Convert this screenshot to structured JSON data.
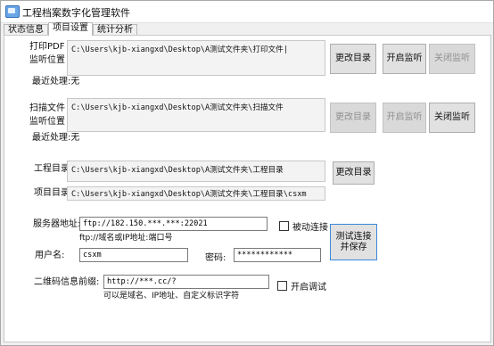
{
  "window": {
    "title": "工程档案数字化管理软件"
  },
  "tabs": [
    "状态信息",
    "项目设置",
    "统计分析"
  ],
  "print_monitor": {
    "label_line1": "打印PDF",
    "label_line2": "监听位置",
    "path": "C:\\Users\\kjb-xiangxd\\Desktop\\A测试文件夹\\打印文件|",
    "change_btn": "更改目录",
    "start_btn": "开启监听",
    "stop_btn": "关闭监听",
    "recent": "最近处理:无"
  },
  "scan_monitor": {
    "label_line1": "扫描文件",
    "label_line2": "监听位置",
    "path": "C:\\Users\\kjb-xiangxd\\Desktop\\A测试文件夹\\扫描文件",
    "change_btn": "更改目录",
    "start_btn": "开启监听",
    "stop_btn": "关闭监听",
    "recent": "最近处理:无"
  },
  "project_dirs": {
    "work_label": "工程目录",
    "work_path": "C:\\Users\\kjb-xiangxd\\Desktop\\A测试文件夹\\工程目录",
    "project_label": "项目目录",
    "project_path": "C:\\Users\\kjb-xiangxd\\Desktop\\A测试文件夹\\工程目录\\csxm",
    "change_btn": "更改目录"
  },
  "server": {
    "address_label": "服务器地址:",
    "address_value": "ftp://182.150.***.***:22021",
    "address_hint": "ftp://域名或IP地址:端口号",
    "passive_label": "被动连接",
    "user_label": "用户名:",
    "user_value": "csxm",
    "password_label": "密码:",
    "password_value": "************",
    "test_btn_line1": "测试连接",
    "test_btn_line2": "并保存"
  },
  "qr": {
    "label": "二维码信息前缀:",
    "value": "http://***.cc/?",
    "hint": "可以是域名、IP地址、自定义标识字符",
    "debug_label": "开启调试"
  }
}
